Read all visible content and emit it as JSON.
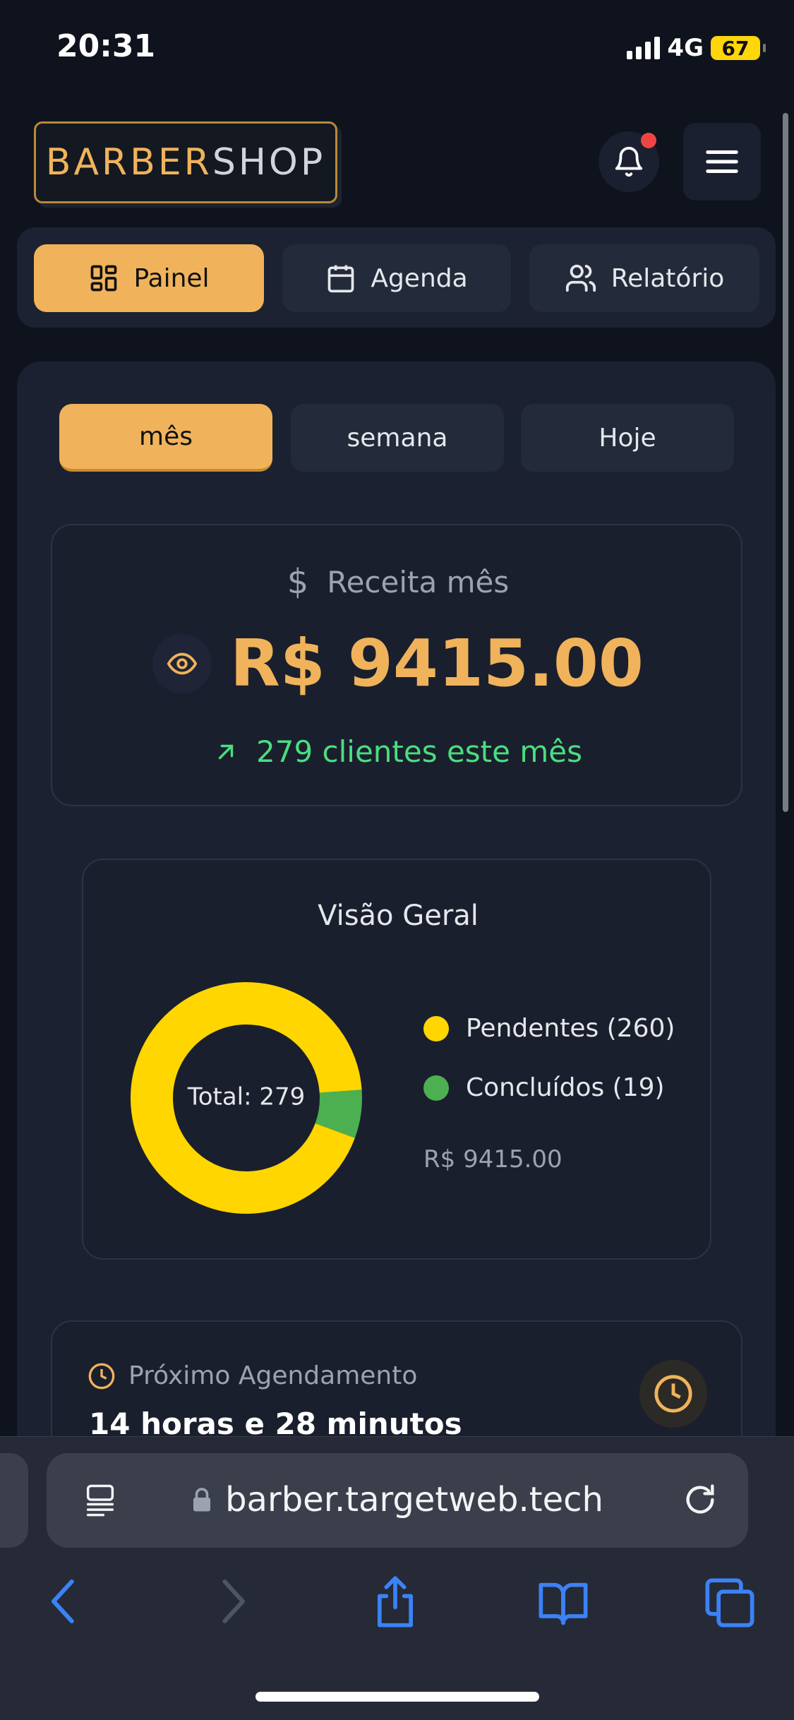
{
  "status": {
    "time": "20:31",
    "network": "4G",
    "battery": "67"
  },
  "header": {
    "logo_part1": "BARBER",
    "logo_part2": "SHOP",
    "bell_icon": "bell-icon",
    "menu_icon": "hamburger-menu-icon"
  },
  "nav": {
    "tabs": [
      {
        "label": "Painel",
        "icon": "dashboard-icon",
        "active": true
      },
      {
        "label": "Agenda",
        "icon": "calendar-icon",
        "active": false
      },
      {
        "label": "Relatório",
        "icon": "users-icon",
        "active": false
      }
    ]
  },
  "period": {
    "tabs": [
      {
        "label": "mês",
        "active": true
      },
      {
        "label": "semana",
        "active": false
      },
      {
        "label": "Hoje",
        "active": false
      }
    ]
  },
  "revenue": {
    "title": "Receita mês",
    "amount": "R$ 9415.00",
    "clients": "279 clientes este mês"
  },
  "overview": {
    "title": "Visão Geral",
    "center_label": "Total: 279",
    "legend": [
      {
        "label": "Pendentes (260)",
        "color": "#ffd600"
      },
      {
        "label": "Concluídos (19)",
        "color": "#4caf50"
      }
    ],
    "total_amount": "R$ 9415.00"
  },
  "chart_data": {
    "type": "pie",
    "categories": [
      "Pendentes",
      "Concluídos"
    ],
    "values": [
      260,
      19
    ],
    "colors": [
      "#ffd600",
      "#4caf50"
    ],
    "center_label": "Total: 279",
    "legend_position": "right"
  },
  "next_appointment": {
    "title": "Próximo Agendamento",
    "time": "14 horas e 28 minutos"
  },
  "browser": {
    "url": "barber.targetweb.tech"
  },
  "colors": {
    "accent": "#f0b35b",
    "background": "#0f131d",
    "card": "#1b2130",
    "positive": "#4ade80"
  }
}
